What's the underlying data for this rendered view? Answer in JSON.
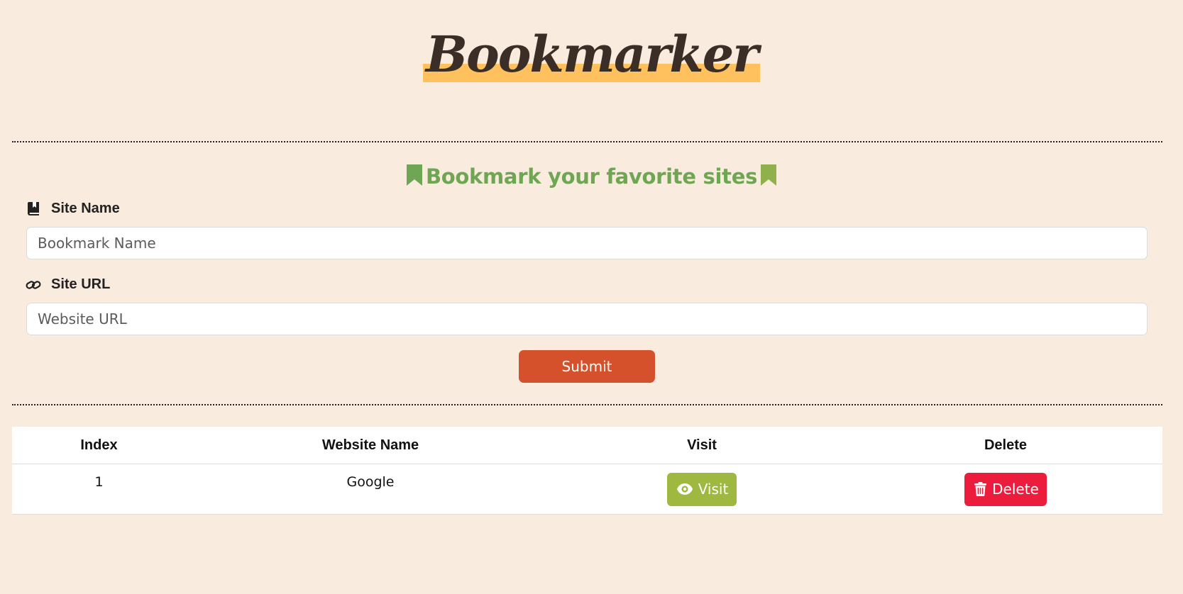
{
  "header": {
    "brand": "Bookmarker"
  },
  "form": {
    "title": "Bookmark your favorite sites",
    "site_name_label": "Site Name",
    "site_name_placeholder": "Bookmark Name",
    "site_name_value": "",
    "site_url_label": "Site URL",
    "site_url_placeholder": "Website URL",
    "site_url_value": "",
    "submit_label": "Submit"
  },
  "table": {
    "headers": [
      "Index",
      "Website Name",
      "Visit",
      "Delete"
    ],
    "rows": [
      {
        "index": "1",
        "name": "Google",
        "visit_label": "Visit",
        "delete_label": "Delete"
      }
    ]
  },
  "colors": {
    "background": "#f9ebdd",
    "brand_highlight": "#ffc15e",
    "title_green": "#6fa653",
    "submit": "#d4512c",
    "visit": "#9fb83f",
    "delete": "#ec1c3c"
  },
  "icons": {
    "title_left": "bookmark-icon",
    "title_right": "bookmark-icon",
    "site_name": "book-bookmark-icon",
    "site_url": "link-icon",
    "visit": "eye-icon",
    "delete": "trash-icon"
  }
}
